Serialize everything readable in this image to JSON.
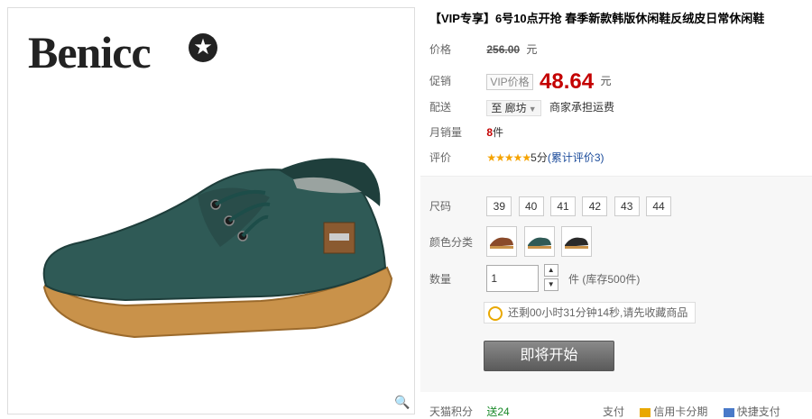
{
  "product_image": {
    "brand": "Benicc",
    "brand_star": "★",
    "zoom_icon": "magnifier-icon"
  },
  "title": "【VIP专享】6号10点开抢 春季新款韩版休闲鞋反绒皮日常休闲鞋",
  "price": {
    "label": "价格",
    "original": "256.00",
    "unit": "元"
  },
  "promo": {
    "label": "促销",
    "badge": "VIP价格",
    "price": "48.64",
    "unit": "元"
  },
  "shipping": {
    "label": "配送",
    "location": "至 廊坊",
    "note": "商家承担运费"
  },
  "sales": {
    "label": "月销量",
    "count": "8",
    "unit": "件"
  },
  "rating": {
    "label": "评价",
    "stars": "★★★★★",
    "score": "5分",
    "reviews": "(累计评价3)"
  },
  "size": {
    "label": "尺码",
    "options": [
      "39",
      "40",
      "41",
      "42",
      "43",
      "44"
    ]
  },
  "color": {
    "label": "颜色分类",
    "swatches": [
      "brown",
      "green",
      "black"
    ]
  },
  "quantity": {
    "label": "数量",
    "value": "1",
    "stock": "件 (库存500件)"
  },
  "countdown": {
    "text": "还剩00小时31分钟14秒,请先收藏商品"
  },
  "start_button": {
    "label": "即将开始"
  },
  "bottom": {
    "points_label": "天猫积分",
    "points_value": "送24",
    "pay_label": "支付",
    "credit_label": "信用卡分期",
    "express_label": "快捷支付"
  },
  "colors": {
    "accent": "#c40000",
    "link": "#1a4a9a",
    "star": "#f5a300"
  }
}
